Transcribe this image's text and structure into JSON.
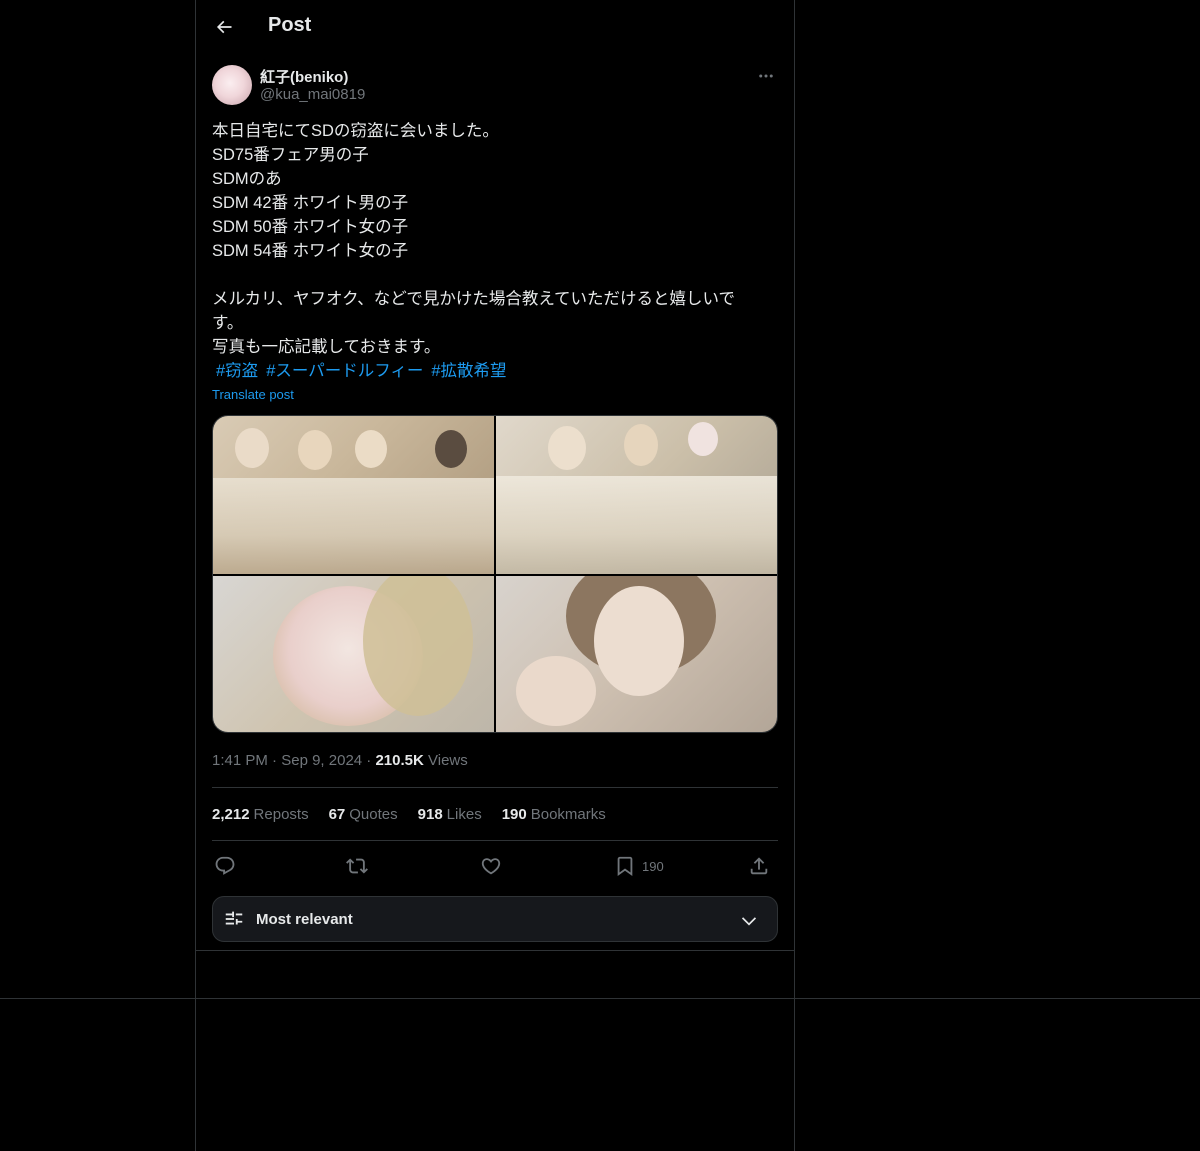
{
  "header": {
    "title": "Post"
  },
  "author": {
    "display_name": "紅子(beniko)",
    "handle": "@kua_mai0819"
  },
  "tweet": {
    "text": "本日自宅にてSDの窃盗に会いました。\nSD75番フェア男の子\nSDMのあ\nSDM 42番 ホワイト男の子\nSDM 50番 ホワイト女の子\nSDM 54番 ホワイト女の子\n\nメルカリ、ヤフオク、などで見かけた場合教えていただけると嬉しいで\nす。\n写真も一応記載しておきます。",
    "hashtags": [
      "#窃盗",
      "#スーパードルフィー",
      "#拡散希望"
    ],
    "translate_label": "Translate post"
  },
  "meta": {
    "time": "1:41 PM",
    "date": "Sep 9, 2024",
    "views_count": "210.5K",
    "views_label": "Views"
  },
  "stats": {
    "reposts": {
      "count": "2,212",
      "label": "Reposts"
    },
    "quotes": {
      "count": "67",
      "label": "Quotes"
    },
    "likes": {
      "count": "918",
      "label": "Likes"
    },
    "bookmarks": {
      "count": "190",
      "label": "Bookmarks"
    }
  },
  "actions": {
    "bookmark_count": "190"
  },
  "sort": {
    "label": "Most relevant"
  },
  "icons": [
    "back-arrow-icon",
    "more-icon",
    "reply-icon",
    "repost-icon",
    "like-icon",
    "bookmark-icon",
    "share-icon",
    "sliders-icon",
    "chevron-down-icon"
  ],
  "colors": {
    "background": "#000000",
    "text": "#e7e9ea",
    "secondary": "#71767b",
    "accent": "#1d9bf0",
    "border": "#2f3336"
  }
}
